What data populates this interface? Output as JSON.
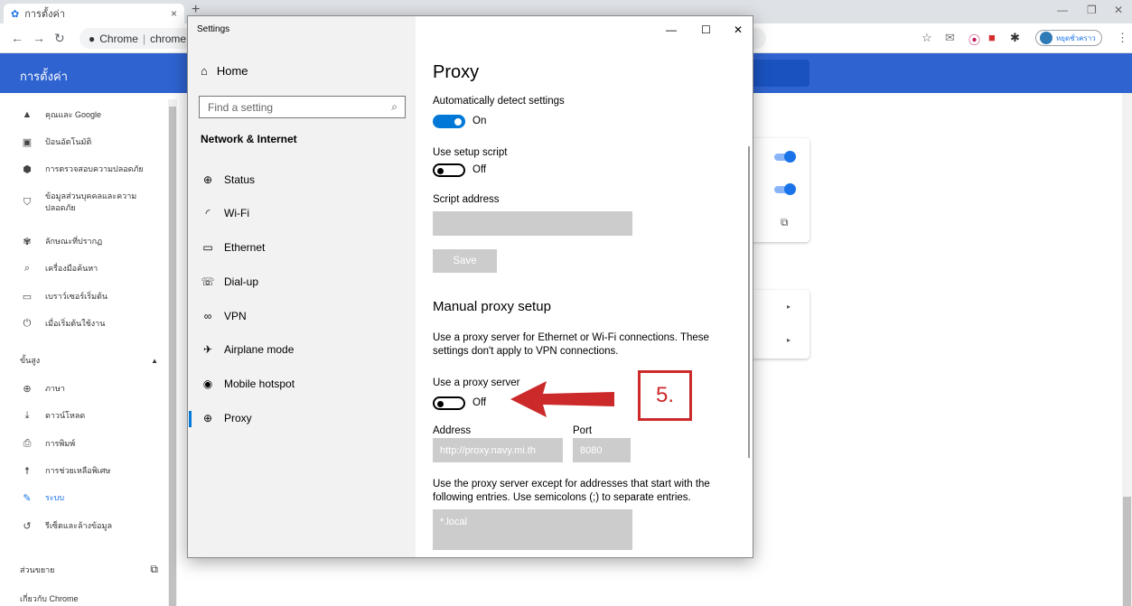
{
  "browser": {
    "tab_title": "การตั้งค่า",
    "omnibox_site": "Chrome",
    "omnibox_url": "chrome:/",
    "profile_label": "หยุดชั่วคราว"
  },
  "chrome_settings": {
    "header_title": "การตั้งค่า",
    "nav": [
      {
        "label": "คุณและ Google",
        "icon": "person-icon"
      },
      {
        "label": "ป้อนอัตโนมัติ",
        "icon": "clipboard-icon"
      },
      {
        "label": "การตรวจสอบความปลอดภัย",
        "icon": "shield-check-icon"
      },
      {
        "label": "ข้อมูลส่วนบุคคลและความปลอดภัย",
        "icon": "shield-icon"
      },
      {
        "label": "ลักษณะที่ปรากฏ",
        "icon": "palette-icon"
      },
      {
        "label": "เครื่องมือค้นหา",
        "icon": "search-icon"
      },
      {
        "label": "เบราว์เซอร์เริ่มต้น",
        "icon": "browser-icon"
      },
      {
        "label": "เมื่อเริ่มต้นใช้งาน",
        "icon": "power-icon"
      }
    ],
    "advanced_label": "ขั้นสูง",
    "advanced_nav": [
      {
        "label": "ภาษา",
        "icon": "globe-icon"
      },
      {
        "label": "ดาวน์โหลด",
        "icon": "download-icon"
      },
      {
        "label": "การพิมพ์",
        "icon": "printer-icon"
      },
      {
        "label": "การช่วยเหลือพิเศษ",
        "icon": "accessibility-icon"
      },
      {
        "label": "ระบบ",
        "icon": "wrench-icon"
      },
      {
        "label": "รีเซ็ตและล้างข้อมูล",
        "icon": "reset-icon"
      }
    ],
    "extensions_label": "ส่วนขยาย",
    "about_label": "เกี่ยวกับ Chrome"
  },
  "win_settings": {
    "window_title": "Settings",
    "home_label": "Home",
    "search_placeholder": "Find a setting",
    "section_title": "Network & Internet",
    "nav": [
      {
        "label": "Status",
        "icon": "status-globe-icon"
      },
      {
        "label": "Wi-Fi",
        "icon": "wifi-icon"
      },
      {
        "label": "Ethernet",
        "icon": "ethernet-icon"
      },
      {
        "label": "Dial-up",
        "icon": "dialup-icon"
      },
      {
        "label": "VPN",
        "icon": "vpn-icon"
      },
      {
        "label": "Airplane mode",
        "icon": "airplane-icon"
      },
      {
        "label": "Mobile hotspot",
        "icon": "hotspot-icon"
      },
      {
        "label": "Proxy",
        "icon": "globe-icon"
      }
    ],
    "active_nav": "Proxy"
  },
  "proxy": {
    "title": "Proxy",
    "auto_detect_label": "Automatically detect settings",
    "auto_detect_state": "On",
    "setup_script_label": "Use setup script",
    "setup_script_state": "Off",
    "script_address_label": "Script address",
    "save_label": "Save",
    "manual_heading": "Manual proxy setup",
    "manual_desc": "Use a proxy server for Ethernet or Wi-Fi connections. These settings don't apply to VPN connections.",
    "use_proxy_label": "Use a proxy server",
    "use_proxy_state": "Off",
    "address_label": "Address",
    "address_value": "http://proxy.navy.mi.th",
    "port_label": "Port",
    "port_value": "8080",
    "exceptions_desc": "Use the proxy server except for addresses that start with the following entries. Use semicolons (;) to separate entries.",
    "exceptions_value": "*.local"
  },
  "annotation": {
    "step_label": "5.",
    "color": "#cc2a2a"
  }
}
